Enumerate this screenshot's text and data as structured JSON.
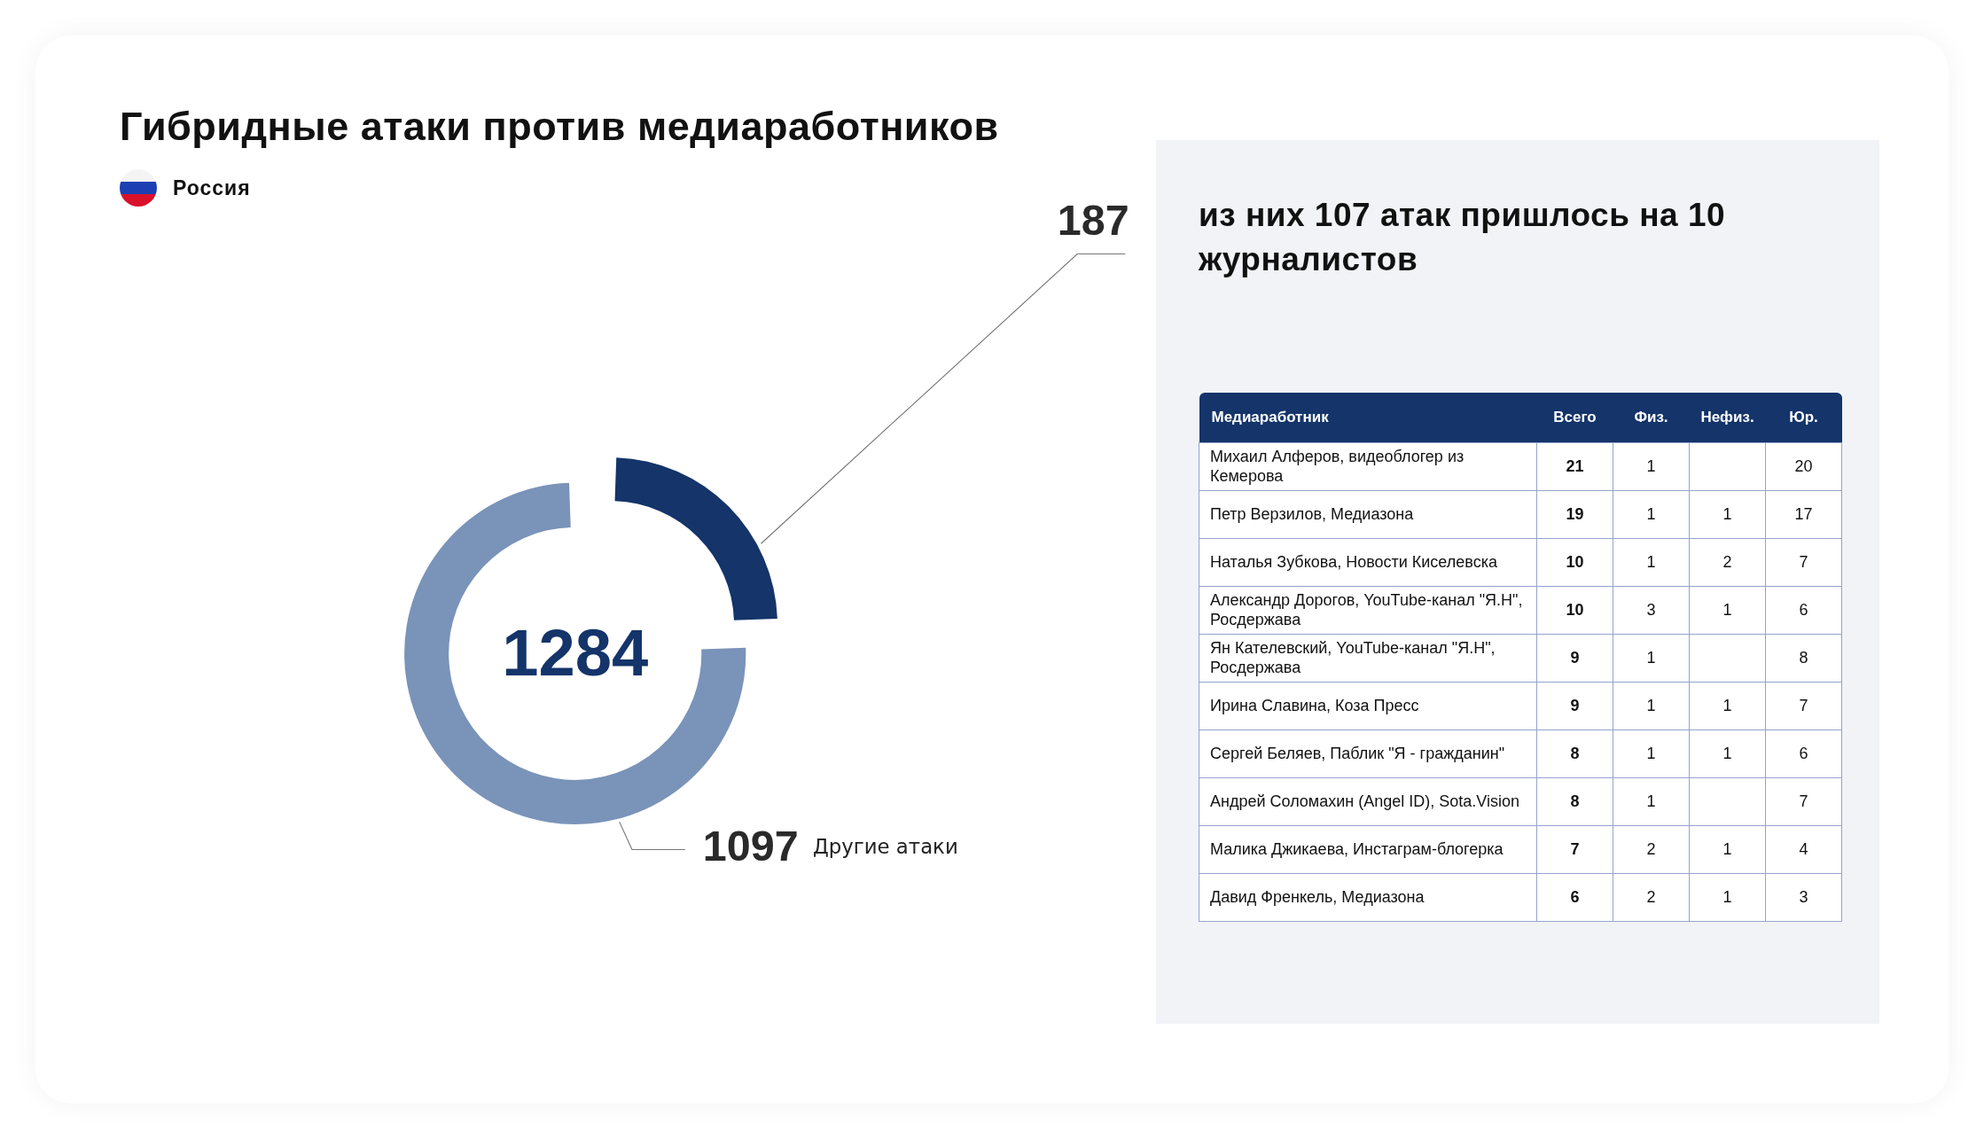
{
  "title": "Гибридные атаки против медиаработников",
  "country": {
    "name": "Россия"
  },
  "chart": {
    "total": "1284",
    "callouts": [
      {
        "value": "187"
      },
      {
        "value": "1097",
        "label": "Другие атаки"
      }
    ]
  },
  "panel": {
    "heading": "из них 107 атак пришлось на 10 журналистов",
    "table": {
      "columns": [
        "Медиаработник",
        "Всего",
        "Физ.",
        "Нефиз.",
        "Юр."
      ],
      "rows": [
        {
          "name": "Михаил Алферов, видеоблогер из Кемерова",
          "total": "21",
          "phys": "1",
          "legal": "20"
        },
        {
          "name": "Петр Верзилов, Медиазона",
          "total": "19",
          "phys": "1",
          "nonphys": "1",
          "legal": "17"
        },
        {
          "name": "Наталья Зубкова, Новости Киселевска",
          "total": "10",
          "phys": "1",
          "nonphys": "2",
          "legal": "7"
        },
        {
          "name": "Александр Дорогов, YouTube-канал \"Я.Н\", Росдержава",
          "total": "10",
          "phys": "3",
          "nonphys": "1",
          "legal": "6"
        },
        {
          "name": "Ян Кателевский, YouTube-канал \"Я.Н\", Росдержава",
          "total": "9",
          "phys": "1",
          "legal": "8"
        },
        {
          "name": "Ирина Славина, Коза Пресс",
          "total": "9",
          "phys": "1",
          "nonphys": "1",
          "legal": "7"
        },
        {
          "name": "Сергей Беляев, Паблик \"Я - гражданин\"",
          "total": "8",
          "phys": "1",
          "nonphys": "1",
          "legal": "6"
        },
        {
          "name": "Андрей Соломахин (Angel ID), Sota.Vision",
          "total": "8",
          "phys": "1",
          "legal": "7"
        },
        {
          "name": "Малика Джикаева, Инстаграм-блогерка",
          "total": "7",
          "phys": "2",
          "nonphys": "1",
          "legal": "4"
        },
        {
          "name": "Давид Френкель, Медиазона",
          "total": "6",
          "phys": "2",
          "nonphys": "1",
          "legal": "3"
        }
      ]
    }
  }
}
